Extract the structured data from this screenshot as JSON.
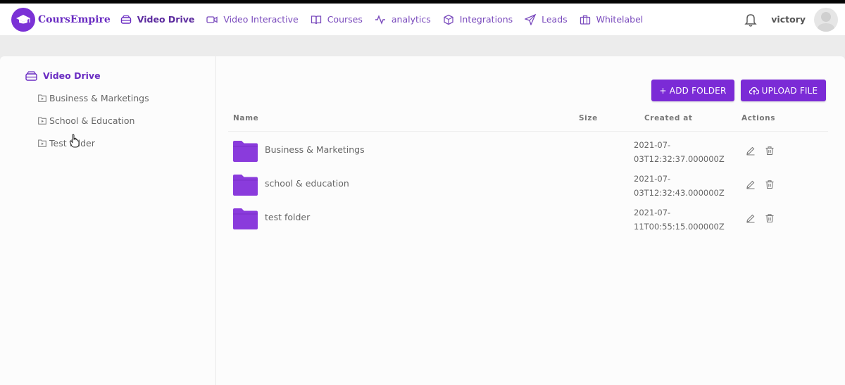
{
  "app": {
    "name": "CoursEmpire"
  },
  "nav": {
    "items": [
      {
        "label": "Video Drive",
        "icon": "drive-icon"
      },
      {
        "label": "Video Interactive",
        "icon": "video-camera-icon"
      },
      {
        "label": "Courses",
        "icon": "book-icon"
      },
      {
        "label": "analytics",
        "icon": "activity-icon"
      },
      {
        "label": "Integrations",
        "icon": "cube-icon"
      },
      {
        "label": "Leads",
        "icon": "send-icon"
      },
      {
        "label": "Whitelabel",
        "icon": "briefcase-icon"
      }
    ],
    "active": "Video Drive"
  },
  "user": {
    "name": "victory"
  },
  "sidebar": {
    "root": "Video Drive",
    "items": [
      {
        "label": "Business & Marketings"
      },
      {
        "label": "School & Education"
      },
      {
        "label": "Test folder"
      }
    ]
  },
  "toolbar": {
    "add_folder": "+ ADD FOLDER",
    "upload_file": "UPLOAD FILE"
  },
  "table": {
    "headers": {
      "name": "Name",
      "size": "Size",
      "created": "Created at",
      "actions": "Actions"
    },
    "rows": [
      {
        "name": "Business & Marketings",
        "size": "",
        "created_1": "2021-07-",
        "created_2": "03T12:32:37.000000Z"
      },
      {
        "name": "school & education",
        "size": "",
        "created_1": "2021-07-",
        "created_2": "03T12:32:43.000000Z"
      },
      {
        "name": "test folder",
        "size": "",
        "created_1": "2021-07-",
        "created_2": "11T00:55:15.000000Z"
      }
    ]
  },
  "colors": {
    "accent": "#7b2bd6",
    "nav_text": "#7a4bbd",
    "folder": "#8a3bdc"
  }
}
